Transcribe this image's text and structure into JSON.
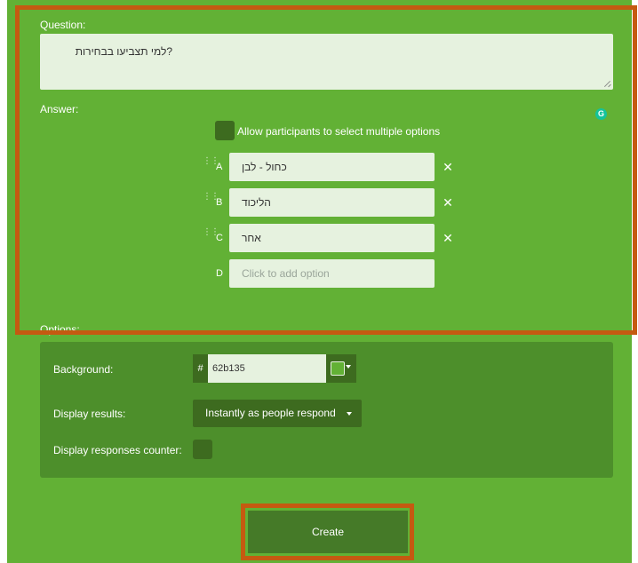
{
  "colors": {
    "panel_bg": "#62b135",
    "options_bg": "#4d8f2b",
    "input_bg": "#e6f2df",
    "dark_control": "#3d6b1f",
    "highlight": "#c55a11"
  },
  "question": {
    "label": "Question:",
    "value": "?למי תצביעו בבחירות"
  },
  "answer": {
    "label": "Answer:",
    "multi_label": "Allow participants to select multiple options",
    "items": [
      {
        "letter": "A",
        "value": "כחול - לבן"
      },
      {
        "letter": "B",
        "value": "הליכוד"
      },
      {
        "letter": "C",
        "value": "אחר"
      },
      {
        "letter": "D",
        "placeholder": "Click to add option"
      }
    ],
    "remove_icon": "✕"
  },
  "options": {
    "label": "Options:",
    "background_label": "Background:",
    "hex_prefix": "#",
    "hex_value": "62b135",
    "display_results_label": "Display results:",
    "display_results_value": "Instantly as people respond",
    "responses_counter_label": "Display responses counter:"
  },
  "create_label": "Create",
  "grammarly_glyph": "G"
}
